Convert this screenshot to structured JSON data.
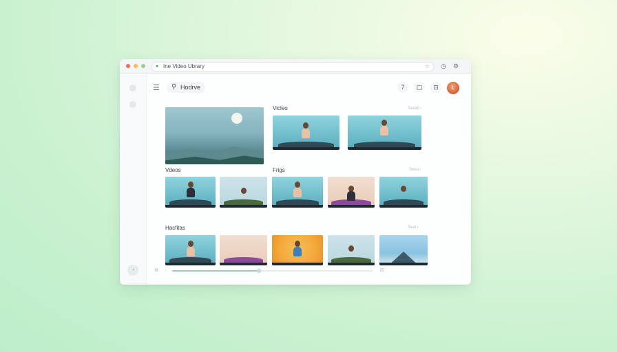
{
  "browser": {
    "url_text": "Ine Video Ubrary",
    "lock_icon": "lock-icon",
    "star_icon": "star-icon",
    "toolbar_icons": [
      "clock-icon",
      "settings-icon"
    ]
  },
  "header": {
    "menu_icon": "hamburger-menu-icon",
    "search_label": "Hodrve",
    "buttons": [
      {
        "name": "help-button",
        "glyph": "7"
      },
      {
        "name": "screen-button",
        "glyph": "▢"
      },
      {
        "name": "camera-button",
        "glyph": "⊡"
      }
    ],
    "avatar_initial": "L"
  },
  "sections": {
    "featured": {
      "title": "Vicleo",
      "see_all": "Seeall ›"
    },
    "row1": {
      "title": "Vdeos",
      "title2": "Frigs",
      "see_all": "Seea ›"
    },
    "row2": {
      "title": "Hacfitas",
      "see_all": "Seal ›"
    }
  },
  "player": {
    "progress": 0.43,
    "left_icon": "gear-icon",
    "right_icon": "fullscreen-icon"
  },
  "colors": {
    "accent": "#9fc9ba",
    "avatar": "#d9693c"
  }
}
